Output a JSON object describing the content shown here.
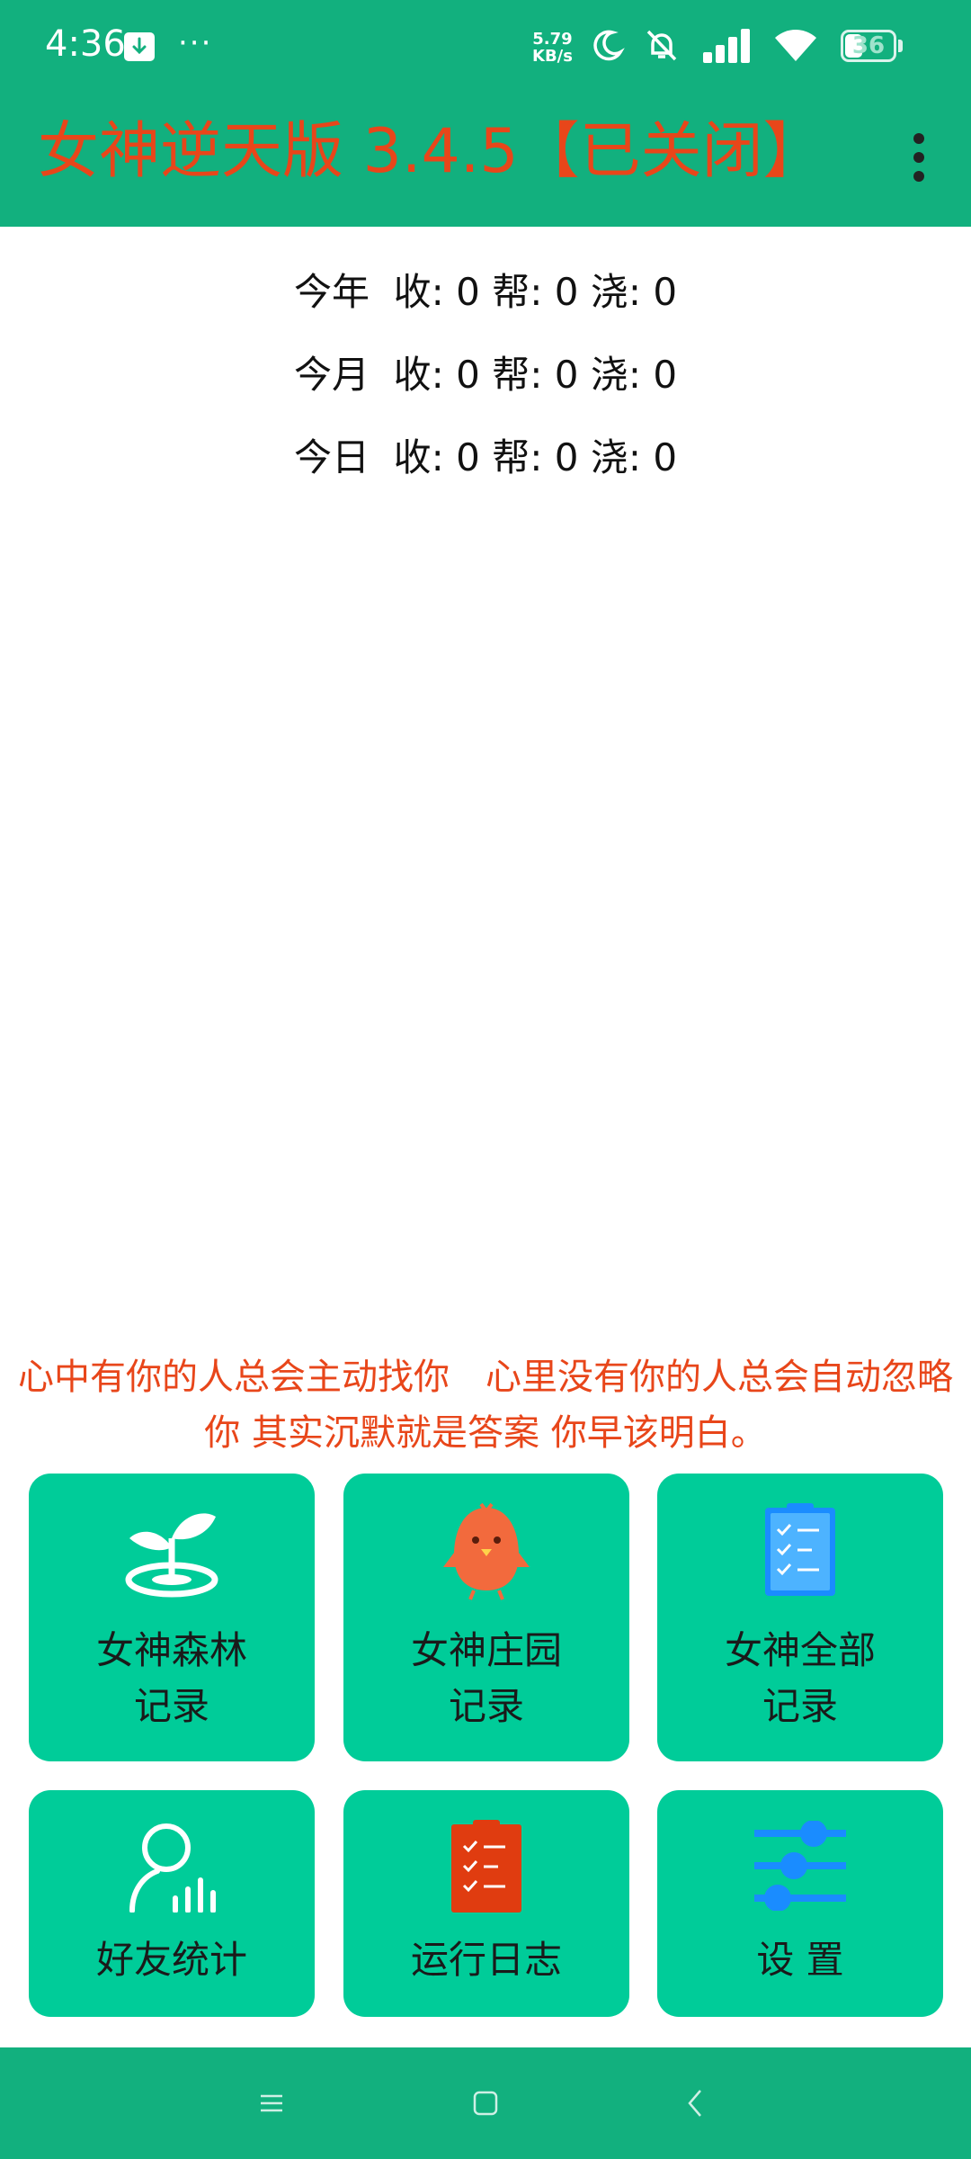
{
  "status_bar": {
    "time": "4:36",
    "more": "···",
    "net_speed_value": "5.79",
    "net_speed_unit": "KB/s",
    "battery": "36",
    "battery_level": 0.36,
    "icons": [
      "download-icon",
      "moon-icon",
      "bell-off-icon",
      "signal-icon",
      "wifi-icon",
      "battery-icon"
    ]
  },
  "app_bar": {
    "title": "女神逆天版 3.4.5【已关闭】",
    "menu_icon": "more-vert-icon"
  },
  "stats": [
    {
      "label": "今年",
      "text": "收: 0 帮: 0 浇: 0"
    },
    {
      "label": "今月",
      "text": "收: 0 帮: 0 浇: 0"
    },
    {
      "label": "今日",
      "text": "收: 0 帮: 0 浇: 0"
    }
  ],
  "quote": "心中有你的人总会主动找你　心里没有你的人总会自动忽略你 其实沉默就是答案 你早该明白。",
  "tiles": [
    {
      "line1": "女神森林",
      "line2": "记录",
      "icon": "sprout-icon"
    },
    {
      "line1": "女神庄园",
      "line2": "记录",
      "icon": "chick-icon"
    },
    {
      "line1": "女神全部",
      "line2": "记录",
      "icon": "clipboard-checklist-icon"
    },
    {
      "line1": "好友统计",
      "icon": "user-stats-icon"
    },
    {
      "line1": "运行日志",
      "icon": "log-clipboard-icon"
    },
    {
      "line1": "设 置",
      "icon": "sliders-icon"
    }
  ],
  "nav_bar": {
    "buttons": [
      "recents-icon",
      "home-icon",
      "back-icon"
    ]
  },
  "colors": {
    "primary": "#12b07e",
    "tile": "#00cc99",
    "accent_red": "#e8461a",
    "icon_blue": "#1a8cff"
  }
}
